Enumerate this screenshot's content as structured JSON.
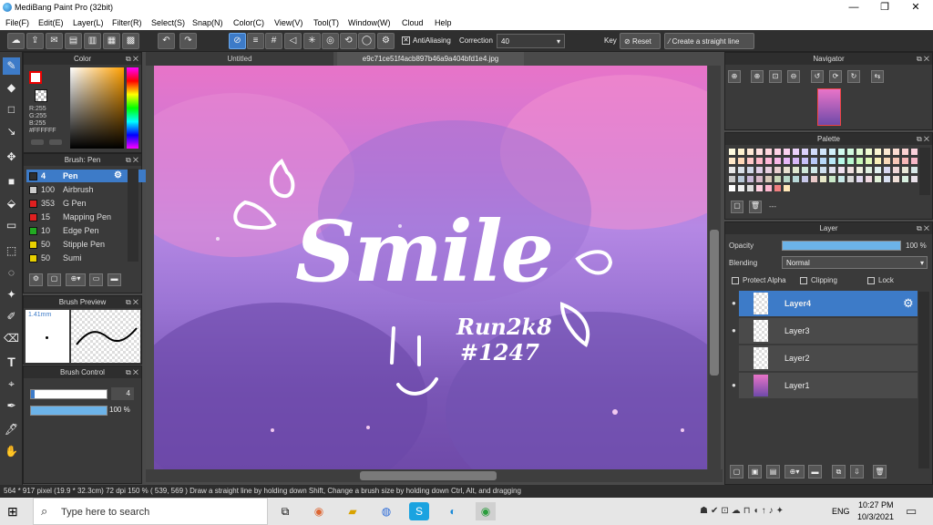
{
  "window": {
    "title": "MediBang Paint Pro (32bit)",
    "min": "—",
    "max": "❐",
    "close": "✕"
  },
  "menu": [
    "File(F)",
    "Edit(E)",
    "Layer(L)",
    "Filter(R)",
    "Select(S)",
    "Snap(N)",
    "Color(C)",
    "View(V)",
    "Tool(T)",
    "Window(W)",
    "Cloud",
    "Help"
  ],
  "toolbar": {
    "antialiasing_label": "AntiAliasing",
    "correction_label": "Correction",
    "correction_value": "40",
    "key_label": "Key",
    "reset_label": "Reset",
    "straight_line_label": "Create a straight line"
  },
  "tabs": {
    "untitled": "Untitled",
    "file": "e9c71ce51f4acb897b46a9a404bfd1e4.jpg"
  },
  "color_panel": {
    "title": "Color",
    "r": "R:255",
    "g": "G:255",
    "b": "B:255",
    "hex": "#FFFFFF"
  },
  "brush_panel": {
    "title": "Brush: Pen",
    "items": [
      {
        "size": "4",
        "name": "Pen",
        "color": "#2e2e2e"
      },
      {
        "size": "100",
        "name": "Airbrush",
        "color": "#cccccc"
      },
      {
        "size": "353",
        "name": "G Pen",
        "color": "#e02020"
      },
      {
        "size": "15",
        "name": "Mapping Pen",
        "color": "#e02020"
      },
      {
        "size": "10",
        "name": "Edge Pen",
        "color": "#22aa22"
      },
      {
        "size": "50",
        "name": "Stipple Pen",
        "color": "#e8d000"
      },
      {
        "size": "50",
        "name": "Sumi",
        "color": "#e8d000"
      }
    ]
  },
  "brush_preview": {
    "title": "Brush Preview",
    "size": "1.41mm"
  },
  "brush_control": {
    "title": "Brush Control",
    "size_value": "4",
    "opacity_value": "100 %"
  },
  "navigator": {
    "title": "Navigator"
  },
  "palette": {
    "title": "Palette",
    "extra": "---"
  },
  "layer_panel": {
    "title": "Layer",
    "opacity_label": "Opacity",
    "opacity_value": "100 %",
    "blending_label": "Blending",
    "blending_value": "Normal",
    "protect_alpha": "Protect Alpha",
    "clipping": "Clipping",
    "lock": "Lock",
    "layers": [
      "Layer4",
      "Layer3",
      "Layer2",
      "Layer1"
    ]
  },
  "artwork": {
    "text": "Smile",
    "signature_line1": "Run2k8",
    "signature_line2": "#1247"
  },
  "statusbar": {
    "text": "564 * 917 pixel   (19.9 * 32.3cm)   72 dpi   150 %   ( 539, 569 )   Draw a straight line by holding down Shift, Change a brush size by holding down Ctrl, Alt, and dragging"
  },
  "taskbar": {
    "search_placeholder": "Type here to search",
    "time": "10:27 PM",
    "date": "10/3/2021",
    "lang": "ENG"
  },
  "colors": {
    "accent": "#3d7bc8",
    "panel": "#3a3a3a",
    "dark": "#2d2d2d"
  }
}
